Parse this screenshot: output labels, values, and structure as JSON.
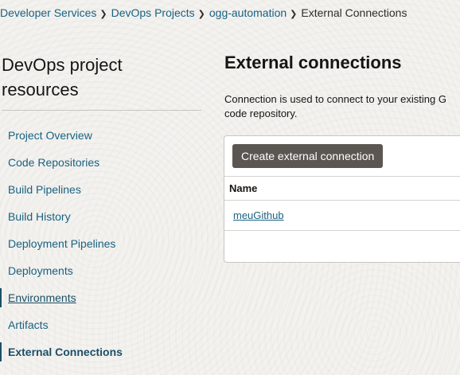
{
  "breadcrumb": {
    "items": [
      "Developer Services",
      "DevOps Projects",
      "ogg-automation"
    ],
    "current": "External Connections"
  },
  "sidebar": {
    "title": "DevOps project resources",
    "items": [
      {
        "label": "Project Overview"
      },
      {
        "label": "Code Repositories"
      },
      {
        "label": "Build Pipelines"
      },
      {
        "label": "Build History"
      },
      {
        "label": "Deployment Pipelines"
      },
      {
        "label": "Deployments"
      },
      {
        "label": "Environments"
      },
      {
        "label": "Artifacts"
      },
      {
        "label": "External Connections"
      }
    ],
    "active": "External Connections"
  },
  "main": {
    "title": "External connections",
    "description": "Connection is used to connect to your existing G code repository.",
    "create_button": "Create external connection",
    "table": {
      "columns": [
        "Name"
      ],
      "rows": [
        [
          "meuGithub"
        ]
      ]
    }
  },
  "colors": {
    "link": "#1a6282",
    "button_bg": "#5b5652",
    "page_bg": "#f3f2ef"
  }
}
